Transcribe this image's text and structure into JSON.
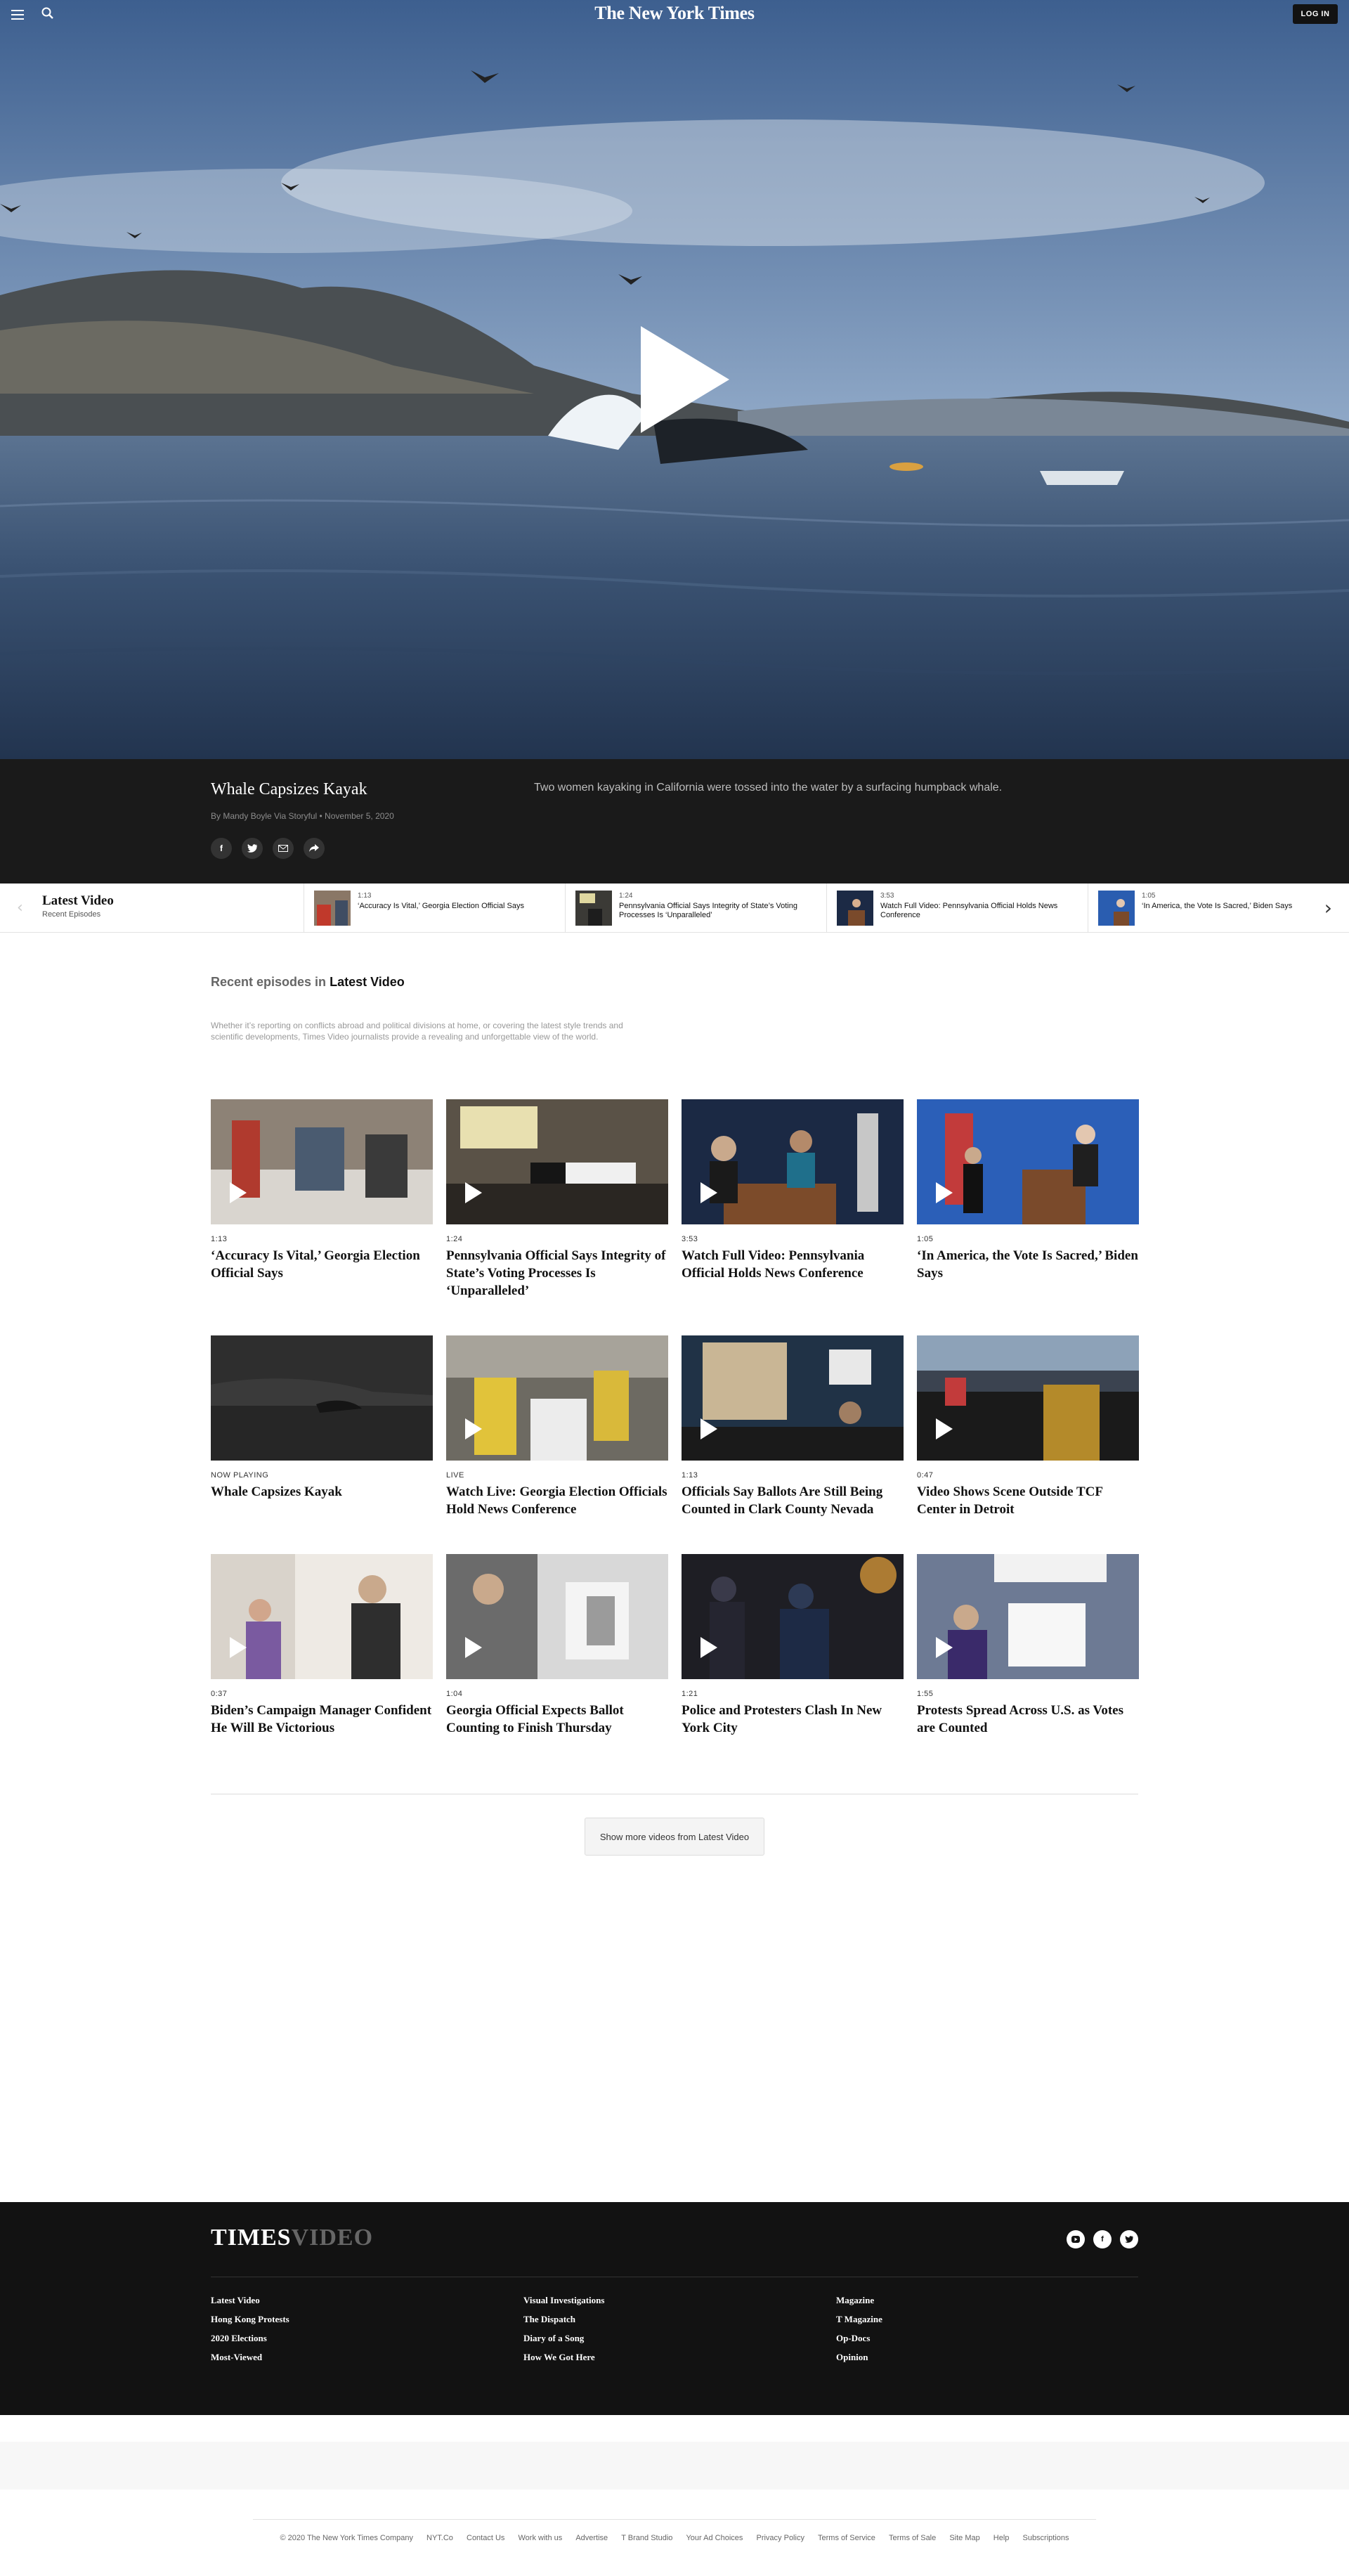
{
  "header": {
    "logo": "The New York Times",
    "login_label": "LOG IN"
  },
  "hero": {
    "title": "Whale Capsizes Kayak",
    "byline": "By Mandy Boyle Via Storyful • November 5, 2020",
    "summary": "Two women kayaking in California were tossed into the water by a surfacing humpback whale."
  },
  "share": [
    "facebook-icon",
    "twitter-icon",
    "email-icon",
    "share-icon"
  ],
  "strip": {
    "title": "Latest Video",
    "subtitle": "Recent Episodes",
    "items": [
      {
        "duration": "1:13",
        "headline": "‘Accuracy Is Vital,’ Georgia Election Official Says"
      },
      {
        "duration": "1:24",
        "headline": "Pennsylvania Official Says Integrity of State’s Voting Processes Is ‘Unparalleled’"
      },
      {
        "duration": "3:53",
        "headline": "Watch Full Video: Pennsylvania Official Holds News Conference"
      },
      {
        "duration": "1:05",
        "headline": "‘In America, the Vote Is Sacred,’ Biden Says"
      }
    ]
  },
  "section": {
    "prefix": "Recent episodes in",
    "name": "Latest Video",
    "description": "Whether it’s reporting on conflicts abroad and political divisions at home, or covering the latest style trends and scientific developments, Times Video journalists provide a revealing and unforgettable view of the world."
  },
  "cards": [
    {
      "meta": "1:13",
      "title": "‘Accuracy Is Vital,’ Georgia Election Official Says"
    },
    {
      "meta": "1:24",
      "title": "Pennsylvania Official Says Integrity of State’s Voting Processes Is ‘Unparalleled’"
    },
    {
      "meta": "3:53",
      "title": "Watch Full Video: Pennsylvania Official Holds News Conference"
    },
    {
      "meta": "1:05",
      "title": "‘In America, the Vote Is Sacred,’ Biden Says"
    },
    {
      "meta": "NOW PLAYING",
      "title": "Whale Capsizes Kayak"
    },
    {
      "meta": "LIVE",
      "title": "Watch Live: Georgia Election Officials Hold News Conference"
    },
    {
      "meta": "1:13",
      "title": "Officials Say Ballots Are Still Being Counted in Clark County Nevada"
    },
    {
      "meta": "0:47",
      "title": "Video Shows Scene Outside TCF Center in Detroit"
    },
    {
      "meta": "0:37",
      "title": "Biden’s Campaign Manager Confident He Will Be Victorious"
    },
    {
      "meta": "1:04",
      "title": "Georgia Official Expects Ballot Counting to Finish Thursday"
    },
    {
      "meta": "1:21",
      "title": "Police and Protesters Clash In New York City"
    },
    {
      "meta": "1:55",
      "title": "Protests Spread Across U.S. as Votes are Counted"
    }
  ],
  "show_more_label": "Show more videos from Latest Video",
  "footer": {
    "logo_main": "TIMES",
    "logo_dim": "VIDEO",
    "col1": [
      "Latest Video",
      "Hong Kong Protests",
      "2020 Elections",
      "Most-Viewed"
    ],
    "col2": [
      "Visual Investigations",
      "The Dispatch",
      "Diary of a Song",
      "How We Got Here"
    ],
    "col3": [
      "Magazine",
      "T Magazine",
      "Op-Docs",
      "Opinion"
    ]
  },
  "legal": [
    "© 2020 The New York Times Company",
    "NYT.Co",
    "Contact Us",
    "Work with us",
    "Advertise",
    "T Brand Studio",
    "Your Ad Choices",
    "Privacy Policy",
    "Terms of Service",
    "Terms of Sale",
    "Site Map",
    "Help",
    "Subscriptions"
  ],
  "colors": {
    "accent_dark": "#121212",
    "caption_bg": "#1a1a1a",
    "footer_bg": "#121212"
  }
}
